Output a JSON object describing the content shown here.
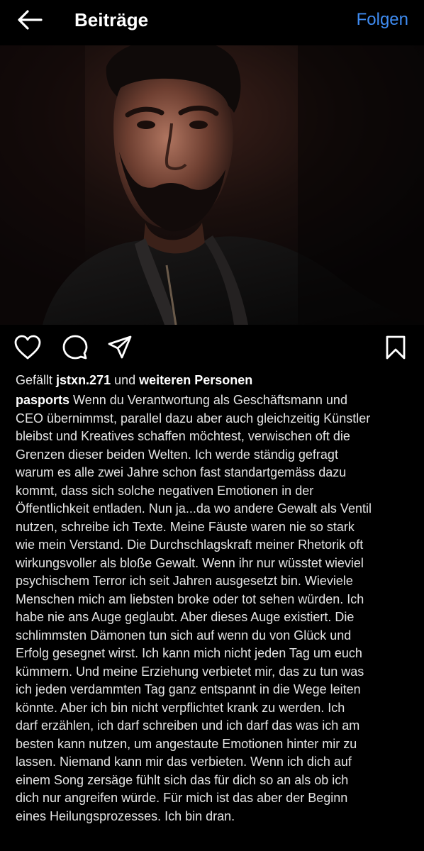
{
  "header": {
    "title": "Beiträge",
    "follow_label": "Folgen"
  },
  "icons": {
    "back": "arrow-left-icon",
    "like": "heart-icon",
    "comment": "comment-bubble-icon",
    "share": "paper-plane-icon",
    "save": "bookmark-icon"
  },
  "likes": {
    "prefix": "Gefällt",
    "user": "jstxn.271",
    "middle": "und",
    "suffix": "weiteren Personen"
  },
  "caption": {
    "username": "pasports",
    "lines": [
      "Wenn du Verantwortung als Geschäftsmann und",
      "CEO übernimmst, parallel dazu aber auch gleichzeitig Künstler",
      "bleibst und Kreatives schaffen möchtest, verwischen oft die",
      "Grenzen dieser beiden Welten. Ich werde ständig gefragt",
      "warum es alle zwei Jahre schon fast standartgemäss dazu",
      "kommt, dass sich solche negativen Emotionen in der",
      "Öffentlichkeit entladen. Nun ja...da wo andere Gewalt als Ventil",
      "nutzen, schreibe ich Texte. Meine Fäuste waren nie so stark",
      "wie mein Verstand. Die Durchschlagskraft meiner Rhetorik oft",
      "wirkungsvoller als bloße Gewalt. Wenn ihr nur wüsstet wieviel",
      "psychischem Terror ich seit Jahren ausgesetzt bin. Wieviele",
      "Menschen mich am liebsten broke oder tot sehen würden. Ich",
      "habe nie ans Auge geglaubt. Aber dieses Auge existiert. Die",
      "schlimmsten Dämonen tun sich auf wenn du von Glück und",
      "Erfolg gesegnet wirst. Ich kann mich nicht jeden Tag um euch",
      "kümmern. Und meine Erziehung verbietet mir, das zu tun was",
      "ich jeden verdammten Tag ganz entspannt in die Wege leiten",
      "könnte. Aber ich bin nicht verpflichtet krank zu werden. Ich",
      "darf erzählen, ich darf schreiben und ich darf das was ich am",
      "besten kann nutzen, um angestaute Emotionen hinter mir zu",
      "lassen. Niemand kann mir das verbieten. Wenn ich dich auf",
      "einem Song zersäge fühlt sich das für dich so an als ob ich",
      "dich nur angreifen würde. Für mich ist das aber der Beginn",
      "eines Heilungsprozesses. Ich bin dran."
    ]
  },
  "colors": {
    "background": "#000000",
    "accent": "#3f8cf2",
    "text": "#f5f5f5"
  }
}
